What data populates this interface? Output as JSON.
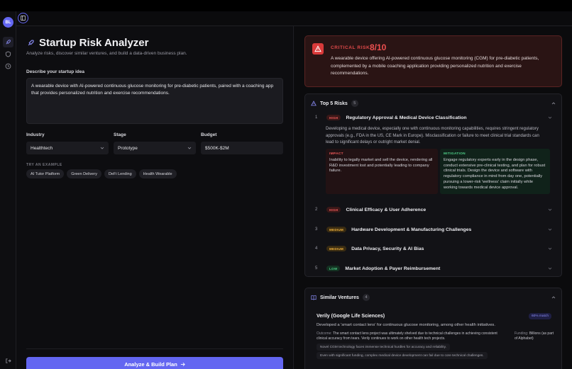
{
  "sidebar": {
    "avatar_initials": "BL"
  },
  "form": {
    "title": "Startup Risk Analyzer",
    "subtitle": "Analyze risks, discover similar ventures, and build a data-driven business plan.",
    "idea_label": "Describe your startup idea",
    "idea_value": "A wearable device with AI-powered continuous glucose monitoring for pre-diabetic patients, paired with a coaching app that provides personalized nutrition and exercise recommendations.",
    "industry_label": "Industry",
    "industry_value": "Healthtech",
    "stage_label": "Stage",
    "stage_value": "Prototype",
    "budget_label": "Budget",
    "budget_value": "$500K-$2M",
    "examples_label": "TRY AN EXAMPLE",
    "examples": [
      "AI Tutor Platform",
      "Green Delivery",
      "DeFi Lending",
      "Health Wearable"
    ],
    "submit_label": "Analyze & Build Plan"
  },
  "critical": {
    "label": "CRITICAL RISK",
    "score": "8/10",
    "description": "A wearable device offering AI-powered continuous glucose monitoring (CGM) for pre-diabetic patients, complemented by a mobile coaching application providing personalized nutrition and exercise recommendations."
  },
  "risks": {
    "title": "Top 5 Risks",
    "count": "5",
    "items": [
      {
        "num": "1",
        "level": "HIGH",
        "title": "Regulatory Approval & Medical Device Classification"
      },
      {
        "num": "2",
        "level": "HIGH",
        "title": "Clinical Efficacy & User Adherence"
      },
      {
        "num": "3",
        "level": "MEDIUM",
        "title": "Hardware Development & Manufacturing Challenges"
      },
      {
        "num": "4",
        "level": "MEDIUM",
        "title": "Data Privacy, Security & AI Bias"
      },
      {
        "num": "5",
        "level": "LOW",
        "title": "Market Adoption & Payer Reimbursement"
      }
    ],
    "expanded": {
      "description": "Developing a medical device, especially one with continuous monitoring capabilities, requires stringent regulatory approvals (e.g., FDA in the US, CE Mark in Europe). Misclassification or failure to meet clinical trial standards can lead to significant delays or outright market denial.",
      "impact_label": "IMPACT",
      "impact_text": "Inability to legally market and sell the device, rendering all R&D investment lost and potentially leading to company failure.",
      "mitigation_label": "MITIGATION",
      "mitigation_text": "Engage regulatory experts early in the design phase, conduct extensive pre-clinical testing, and plan for robust clinical trials. Design the device and software with regulatory compliance in mind from day one, potentially pursuing a lower-risk 'wellness' claim initially while working towards medical device approval."
    }
  },
  "similar": {
    "title": "Similar Ventures",
    "count": "4",
    "venture": {
      "name": "Verily (Google Life Sciences)",
      "match": "60% match",
      "description": "Developed a 'smart contact lens' for continuous glucose monitoring, among other health initiatives.",
      "outcome_label": "Outcome:",
      "outcome": "The smart contact lens project was ultimately shelved due to technical challenges in achieving consistent clinical accuracy from tears. Verily continues to work on other health tech projects.",
      "funding_label": "Funding:",
      "funding": "Billions (as part of Alphabet)",
      "tags": [
        "Novel CGM technology faces immense technical hurdles for accuracy and reliability.",
        "Even with significant funding, complex medical device development can fail due to core technical challenges."
      ]
    }
  },
  "colors": {
    "accent": "#6366f1",
    "critical": "#e14a4a",
    "high": "#ef5a5a",
    "medium": "#f2b33d",
    "low": "#4fd08a"
  }
}
